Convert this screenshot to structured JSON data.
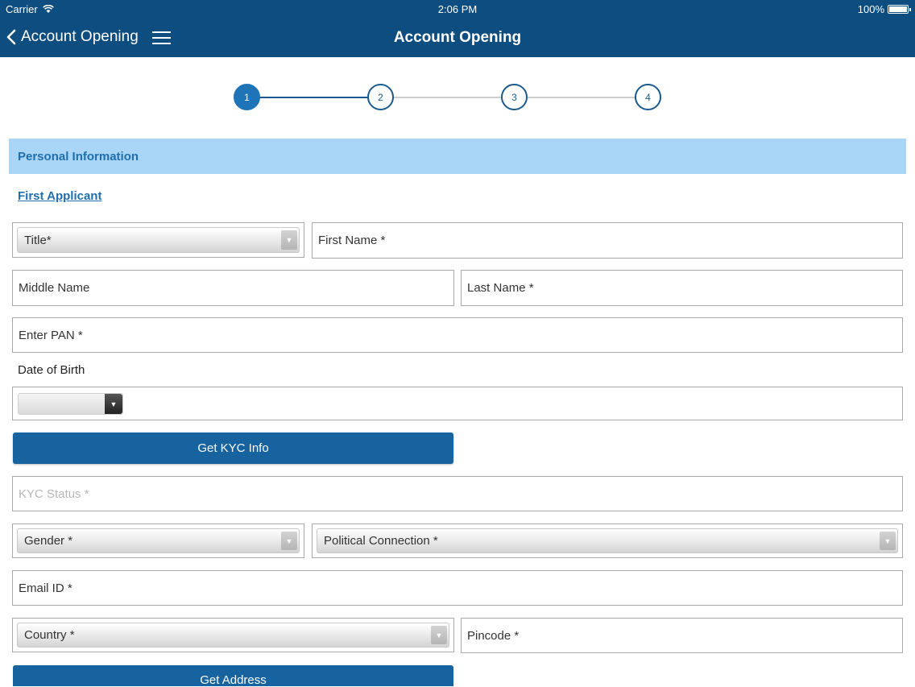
{
  "status_bar": {
    "carrier": "Carrier",
    "time": "2:06 PM",
    "battery": "100%"
  },
  "nav": {
    "back_label": "Account Opening",
    "title": "Account Opening"
  },
  "stepper": {
    "steps": [
      "1",
      "2",
      "3",
      "4"
    ],
    "current_step": 1
  },
  "section": {
    "title": "Personal Information"
  },
  "applicant": {
    "link": "First Applicant"
  },
  "form": {
    "title_select": "Title*",
    "first_name": "First Name *",
    "middle_name": "Middle Name",
    "last_name": "Last Name *",
    "pan": "Enter PAN *",
    "dob_label": "Date of Birth",
    "kyc_button": "Get KYC Info",
    "kyc_status": "KYC Status *",
    "gender_select": "Gender *",
    "political_select": "Political Connection *",
    "email": "Email ID *",
    "country_select": "Country *",
    "pincode": "Pincode *",
    "address_button": "Get Address"
  },
  "colors": {
    "nav": "#0d4d80",
    "section": "#a9d5f6",
    "accent": "#1f74b7",
    "button": "#16639f"
  }
}
